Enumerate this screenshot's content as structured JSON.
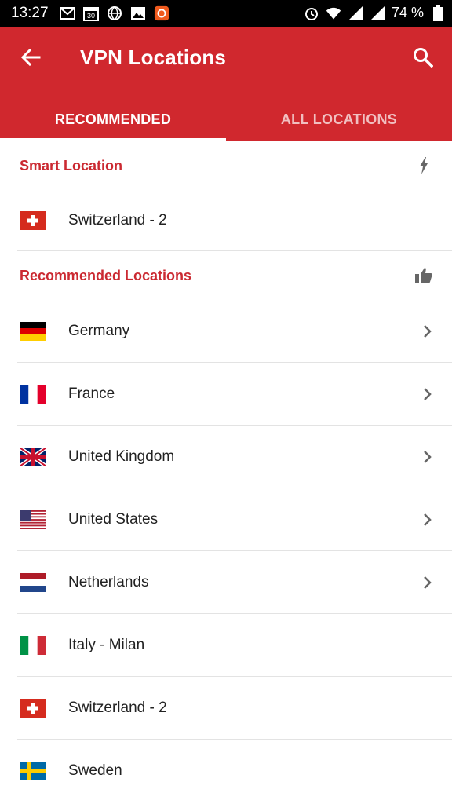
{
  "status_bar": {
    "time": "13:27",
    "battery": "74 %",
    "left_icons": [
      "gmail-icon",
      "calendar-icon",
      "globe-icon",
      "image-icon",
      "app-icon"
    ],
    "calendar_day": "30",
    "right_icons": [
      "alarm-icon",
      "wifi-icon",
      "signal-icon",
      "signal-icon",
      "battery-icon"
    ]
  },
  "app_bar": {
    "title": "VPN Locations",
    "back_icon": "arrow-left-icon",
    "search_icon": "search-icon",
    "background": "#d0282e"
  },
  "tabs": [
    {
      "label": "RECOMMENDED",
      "active": true
    },
    {
      "label": "ALL LOCATIONS",
      "active": false
    }
  ],
  "smart_section": {
    "title": "Smart Location",
    "icon": "lightning-icon",
    "items": [
      {
        "label": "Switzerland - 2",
        "flag": "switzerland"
      }
    ]
  },
  "recommended_section": {
    "title": "Recommended Locations",
    "icon": "thumbs-up-icon",
    "items": [
      {
        "label": "Germany",
        "flag": "germany",
        "has_arrow": true
      },
      {
        "label": "France",
        "flag": "france",
        "has_arrow": true
      },
      {
        "label": "United Kingdom",
        "flag": "uk",
        "has_arrow": true
      },
      {
        "label": "United States",
        "flag": "usa",
        "has_arrow": true
      },
      {
        "label": "Netherlands",
        "flag": "netherlands",
        "has_arrow": true
      },
      {
        "label": "Italy - Milan",
        "flag": "italy",
        "has_arrow": false
      },
      {
        "label": "Switzerland - 2",
        "flag": "switzerland",
        "has_arrow": false
      },
      {
        "label": "Sweden",
        "flag": "sweden",
        "has_arrow": false
      }
    ]
  },
  "colors": {
    "accent": "#d0282e",
    "section_title": "#cb2a32"
  }
}
